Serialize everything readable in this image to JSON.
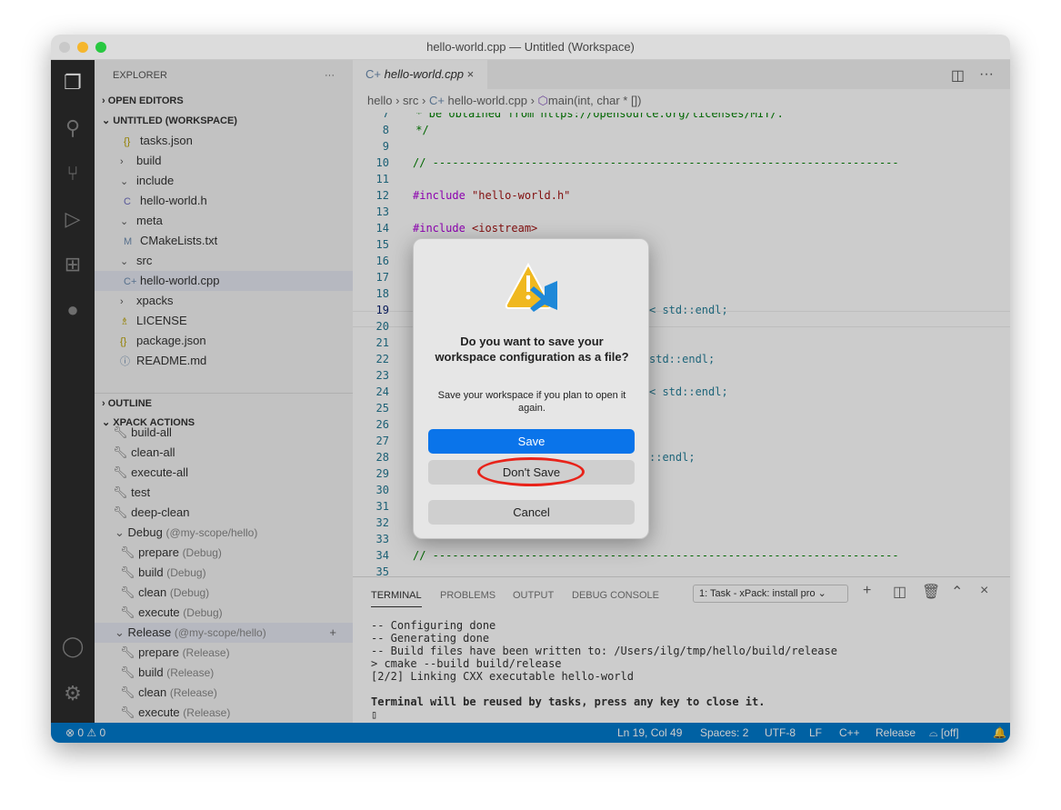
{
  "window": {
    "title": "hello-world.cpp — Untitled (Workspace)"
  },
  "sidebar": {
    "title": "EXPLORER",
    "more": "···",
    "open_editors": "OPEN EDITORS",
    "workspace": "UNTITLED (WORKSPACE)",
    "files": [
      {
        "icon": "{}",
        "label": "tasks.json",
        "indent": 1,
        "color": "#b8a000"
      },
      {
        "icon": "›",
        "label": "build",
        "indent": 0
      },
      {
        "icon": "⌄",
        "label": "include",
        "indent": 0
      },
      {
        "icon": "C",
        "label": "hello-world.h",
        "indent": 1,
        "color": "#6c6cc0"
      },
      {
        "icon": "⌄",
        "label": "meta",
        "indent": 0
      },
      {
        "icon": "M",
        "label": "CMakeLists.txt",
        "indent": 1,
        "color": "#6c8cb0"
      },
      {
        "icon": "⌄",
        "label": "src",
        "indent": 0
      },
      {
        "icon": "C+",
        "label": "hello-world.cpp",
        "indent": 1,
        "color": "#6c8cb0",
        "selected": true
      },
      {
        "icon": "›",
        "label": "xpacks",
        "indent": 0
      },
      {
        "icon": "♗",
        "label": "LICENSE",
        "indent": 0,
        "color": "#b8a000"
      },
      {
        "icon": "{}",
        "label": "package.json",
        "indent": 0,
        "color": "#b8a000"
      },
      {
        "icon": "ⓘ",
        "label": "README.md",
        "indent": 0,
        "color": "#6c8cb0"
      }
    ],
    "outline": "OUTLINE",
    "xpack": "XPACK ACTIONS",
    "actions": [
      {
        "label": "build-all",
        "sub": ""
      },
      {
        "label": "clean-all",
        "sub": ""
      },
      {
        "label": "execute-all",
        "sub": ""
      },
      {
        "label": "test",
        "sub": ""
      },
      {
        "label": "deep-clean",
        "sub": ""
      },
      {
        "label": "Debug",
        "sub": "(@my-scope/hello)",
        "group": true
      },
      {
        "label": "prepare",
        "sub": "(Debug)",
        "child": true
      },
      {
        "label": "build",
        "sub": "(Debug)",
        "child": true
      },
      {
        "label": "clean",
        "sub": "(Debug)",
        "child": true
      },
      {
        "label": "execute",
        "sub": "(Debug)",
        "child": true
      },
      {
        "label": "Release",
        "sub": "(@my-scope/hello)",
        "group": true,
        "selected": true
      },
      {
        "label": "prepare",
        "sub": "(Release)",
        "child": true
      },
      {
        "label": "build",
        "sub": "(Release)",
        "child": true
      },
      {
        "label": "clean",
        "sub": "(Release)",
        "child": true
      },
      {
        "label": "execute",
        "sub": "(Release)",
        "child": true
      }
    ]
  },
  "editor": {
    "tab": "hello-world.cpp",
    "breadcrumb": [
      "hello",
      "src",
      "hello-world.cpp",
      "main(int, char * [])"
    ],
    "line_numbers": [
      "7",
      "8",
      "9",
      "10",
      "11",
      "12",
      "13",
      "14",
      "15",
      "16",
      "17",
      "18",
      "19",
      "20",
      "21",
      "22",
      "23",
      "24",
      "25",
      "26",
      "27",
      "28",
      "29",
      "30",
      "31",
      "32",
      "33",
      "34",
      "35"
    ],
    "line7": " * be obtained from https://opensource.org/licenses/MIT/.",
    "line8": " */",
    "line10": "// -----------------------------------------------------------------------",
    "inc1_kw": "#include",
    "inc1_val": "\"hello-world.h\"",
    "inc2_kw": "#include",
    "inc2_val": "<iostream>",
    "frag19": "< std::endl;",
    "frag22": "std::endl;",
    "frag24": "< std::endl;",
    "frag28": "::endl;",
    "line34": "// -----------------------------------------------------------------------"
  },
  "panel": {
    "tabs": [
      "TERMINAL",
      "PROBLEMS",
      "OUTPUT",
      "DEBUG CONSOLE"
    ],
    "terminal_select": "1: Task - xPack: install pro",
    "terminal": "-- Configuring done\n-- Generating done\n-- Build files have been written to: /Users/ilg/tmp/hello/build/release\n> cmake --build build/release\n[2/2] Linking CXX executable hello-world",
    "terminal_bold": "Terminal will be reused by tasks, press any key to close it."
  },
  "status": {
    "problems": "⊗ 0 ⚠ 0",
    "position": "Ln 19, Col 49",
    "spaces": "Spaces: 2",
    "encoding": "UTF-8",
    "eol": "LF",
    "lang": "C++",
    "config": "Release",
    "live": "[off]"
  },
  "dialog": {
    "title": "Do you want to save your workspace configuration as a file?",
    "message": "Save your workspace if you plan to open it again.",
    "save": "Save",
    "dont_save": "Don't Save",
    "cancel": "Cancel"
  },
  "colors": {
    "accent": "#007acc",
    "primary_button": "#0a74ea",
    "highlight_circle": "#e8231a"
  }
}
